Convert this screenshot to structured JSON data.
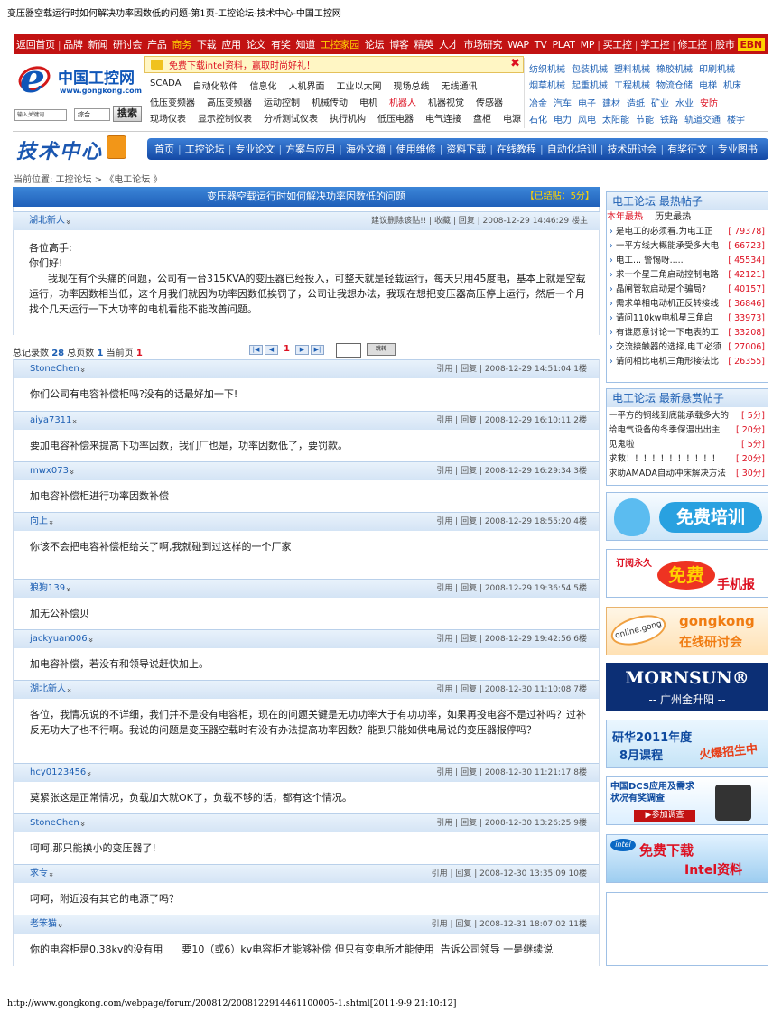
{
  "page_title": "变压器空载运行时如何解决功率因数低的问题-第1页-工控论坛-技术中心-中国工控网",
  "top_nav": [
    {
      "label": "返回首页"
    },
    {
      "label": "|",
      "sep": true
    },
    {
      "label": "品牌"
    },
    {
      "label": "新闻"
    },
    {
      "label": "研讨会"
    },
    {
      "label": "产品"
    },
    {
      "label": "商务",
      "hl": true
    },
    {
      "label": "下载"
    },
    {
      "label": "应用"
    },
    {
      "label": "论文"
    },
    {
      "label": "有奖"
    },
    {
      "label": "知道"
    },
    {
      "label": "工控家园",
      "hl": true
    },
    {
      "label": "论坛"
    },
    {
      "label": "博客"
    },
    {
      "label": "精英"
    },
    {
      "label": "人才"
    },
    {
      "label": "市场研究"
    },
    {
      "label": "WAP"
    },
    {
      "label": "TV"
    },
    {
      "label": "PLAT"
    },
    {
      "label": "MP"
    },
    {
      "label": "|",
      "sep": true
    },
    {
      "label": "买工控"
    },
    {
      "label": "|",
      "sep": true
    },
    {
      "label": "学工控"
    },
    {
      "label": "|",
      "sep": true
    },
    {
      "label": "修工控"
    },
    {
      "label": "|",
      "sep": true
    },
    {
      "label": "股市"
    },
    {
      "label": "EBN",
      "ebn": true
    }
  ],
  "logo": {
    "name": "中国工控网",
    "url": "www.gongkong.com"
  },
  "search": {
    "placeholder": "输入关键词",
    "select": "综合",
    "button": "搜索"
  },
  "promo": {
    "text": "免费下载intel资料，赢取时尚好礼！",
    "close": "✖"
  },
  "keywords_row1": [
    {
      "t": "SCADA"
    },
    {
      "t": "自动化软件"
    },
    {
      "t": "信息化"
    },
    {
      "t": "人机界面"
    },
    {
      "t": "工业以太网"
    },
    {
      "t": "现场总线"
    },
    {
      "t": "无线通讯"
    }
  ],
  "keywords_row2": [
    {
      "t": "低压变频器"
    },
    {
      "t": "高压变频器"
    },
    {
      "t": "运动控制"
    },
    {
      "t": "机械传动"
    },
    {
      "t": "电机"
    },
    {
      "t": "机器人",
      "red": true
    },
    {
      "t": "机器视觉"
    },
    {
      "t": "传感器"
    }
  ],
  "keywords_row3": [
    {
      "t": "现场仪表"
    },
    {
      "t": "显示控制仪表"
    },
    {
      "t": "分析测试仪表"
    },
    {
      "t": "执行机构"
    },
    {
      "t": "低压电器"
    },
    {
      "t": "电气连接"
    },
    {
      "t": "盘柜"
    },
    {
      "t": "电源"
    }
  ],
  "right_cats_1": [
    {
      "t": "纺织机械"
    },
    {
      "t": "包装机械"
    },
    {
      "t": "塑料机械"
    },
    {
      "t": "橡胶机械"
    },
    {
      "t": "印刷机械"
    }
  ],
  "right_cats_2": [
    {
      "t": "烟草机械"
    },
    {
      "t": "起重机械"
    },
    {
      "t": "工程机械"
    },
    {
      "t": "物流仓储"
    },
    {
      "t": "电梯"
    },
    {
      "t": "机床"
    }
  ],
  "right_cats_3": [
    {
      "t": "冶金"
    },
    {
      "t": "汽车"
    },
    {
      "t": "电子"
    },
    {
      "t": "建材"
    },
    {
      "t": "造纸"
    },
    {
      "t": "矿业"
    },
    {
      "t": "水业"
    },
    {
      "t": "安防",
      "red": true
    }
  ],
  "right_cats_4": [
    {
      "t": "石化"
    },
    {
      "t": "电力"
    },
    {
      "t": "风电"
    },
    {
      "t": "太阳能"
    },
    {
      "t": "节能"
    },
    {
      "t": "铁路"
    },
    {
      "t": "轨道交通"
    },
    {
      "t": "楼宇"
    }
  ],
  "section_title": "技术中心",
  "sub_nav": [
    "首页",
    "工控论坛",
    "专业论文",
    "方案与应用",
    "海外文摘",
    "使用维修",
    "资料下载",
    "在线教程",
    "自动化培训",
    "技术研讨会",
    "有奖征文",
    "专业图书"
  ],
  "breadcrumb": "当前位置:   工控论坛 >   《电工论坛 》",
  "thread": {
    "title": "变压器空载运行时如何解决功率因数低的问题",
    "status": "【已结贴：5分】",
    "op_author": "湖北新人",
    "op_meta": "建议删除该贴!! | 收藏 | 回复 | 2008-12-29 14:46:29 楼主",
    "op_body": "各位高手:\n你们好!\n      我现在有个头痛的问题，公司有一台315KVA的变压器已经投入，可整天就是轻载运行，每天只用45度电，基本上就是空载运行，功率因数相当低，这个月我们就因为功率因数低挨罚了，公司让我想办法，我现在想把变压器高压停止运行，然后一个月找个几天运行一下大功率的电机看能不能改善问题。"
  },
  "pager": {
    "total_label": "总记录数",
    "total": "28",
    "pages_label": "总页数",
    "pages": "1",
    "current_label": "当前页",
    "current": "1",
    "buttons": [
      "|◀",
      "◀",
      "1",
      "▶",
      "▶|"
    ],
    "jump": "跳转"
  },
  "replies": [
    {
      "author": "StoneChen",
      "meta": "引用 | 回复 | 2008-12-29 14:51:04 1楼",
      "body": "你们公司有电容补偿柜吗?没有的话最好加一下!"
    },
    {
      "author": "aiya7311",
      "meta": "引用 | 回复 | 2008-12-29 16:10:11 2楼",
      "body": "要加电容补偿来提高下功率因数，我们厂也是，功率因数低了，要罚款。"
    },
    {
      "author": "mwx073",
      "meta": "引用 | 回复 | 2008-12-29 16:29:34 3楼",
      "body": "加电容补偿柜进行功率因数补偿"
    },
    {
      "author": "向上",
      "meta": "引用 | 回复 | 2008-12-29 18:55:20 4楼",
      "body": "你该不会把电容补偿柜给关了啊,我就碰到过这样的一个厂家"
    },
    {
      "author": "狼狗139",
      "meta": "引用 | 回复 | 2008-12-29 19:36:54 5楼",
      "body": "加无公补偿贝"
    },
    {
      "author": "jackyuan006",
      "meta": "引用 | 回复 | 2008-12-29 19:42:56 6楼",
      "body": "加电容补偿，若没有和领导说赶快加上。"
    },
    {
      "author": "湖北新人",
      "meta": "引用 | 回复 | 2008-12-30 11:10:08 7楼",
      "body": "各位，我情况说的不详细，我们并不是没有电容柜，现在的问题关键是无功功率大于有功功率，如果再投电容不是过补吗？过补反无功大了也不行啊。我说的问题是变压器空载时有没有办法提高功率因数？能到只能如供电局说的变压器报停吗？"
    },
    {
      "author": "hcy0123456",
      "meta": "引用 | 回复 | 2008-12-30 11:21:17 8楼",
      "body": "莫紧张这是正常情况，负载加大就OK了，负载不够的话，都有这个情况。"
    },
    {
      "author": "StoneChen",
      "meta": "引用 | 回复 | 2008-12-30 13:26:25 9楼",
      "body": "呵呵,那只能换小的变压器了!"
    },
    {
      "author": "求专",
      "meta": "引用 | 回复 | 2008-12-30 13:35:09 10楼",
      "body": "呵呵，附近没有其它的电源了吗？"
    },
    {
      "author": "老笨猫",
      "meta": "引用 | 回复 | 2008-12-31 18:07:02 11楼",
      "body": "你的电容柜是0.38kv的没有用      要10（或6）kv电容柜才能够补偿 但只有变电所才能使用  告诉公司领导 一是继续说"
    }
  ],
  "hot": {
    "title": "电工论坛 最热帖子",
    "tab_year": "本年最热",
    "tab_hist": "历史最热",
    "items": [
      {
        "t": "是电工的必须看.为电工正",
        "c": "[ 79378]"
      },
      {
        "t": "一平方线大概能承受多大电",
        "c": "[ 66723]"
      },
      {
        "t": "电工... 警惕呀.....",
        "c": "[ 45534]"
      },
      {
        "t": "求一个星三角启动控制电路",
        "c": "[ 42121]"
      },
      {
        "t": "晶闸管软启动是个骗局?",
        "c": "[ 40157]"
      },
      {
        "t": "需求单相电动机正反转接线",
        "c": "[ 36846]"
      },
      {
        "t": "请问110kw电机星三角启",
        "c": "[ 33973]"
      },
      {
        "t": "有谁愿意讨论一下电表的工",
        "c": "[ 33208]"
      },
      {
        "t": "交流接触器的选择,电工必须",
        "c": "[ 27006]"
      },
      {
        "t": "请问相比电机三角形接法比",
        "c": "[ 26355]"
      }
    ]
  },
  "reward": {
    "title": "电工论坛 最新悬赏帖子",
    "items": [
      {
        "t": "一平方的铜线到底能承载多大的",
        "c": "[ 5分]"
      },
      {
        "t": "给电气设备的冬季保温出出主",
        "c": "[ 20分]"
      },
      {
        "t": "见鬼啦",
        "c": "[ 5分]"
      },
      {
        "t": "求救！！！！！！！！！！！",
        "c": "[ 20分]"
      },
      {
        "t": "求助AMADA自动冲床解决方法",
        "c": "[ 30分]"
      }
    ]
  },
  "ads": {
    "a1": "免费培训",
    "a2a": "订阅永久",
    "a2b": "免费",
    "a2c": "手机报",
    "a3a": "online.gong",
    "a3b": "gongkong",
    "a3c": "在线研讨会",
    "a4a": "MORNSUN®",
    "a4b": "-- 广州金升阳 --",
    "a5a": "研华2011年度",
    "a5b": "8月课程",
    "a5c": "火爆招生中",
    "a6a": "中国DCS应用及需求\n状况有奖调查",
    "a6b": "▶参加调查",
    "a7a": "intel",
    "a7b": "免费下载",
    "a7c": "Intel资料"
  },
  "footer": "http://www.gongkong.com/webpage/forum/200812/2008122914461100005-1.shtml[2011-9-9 21:10:12]"
}
